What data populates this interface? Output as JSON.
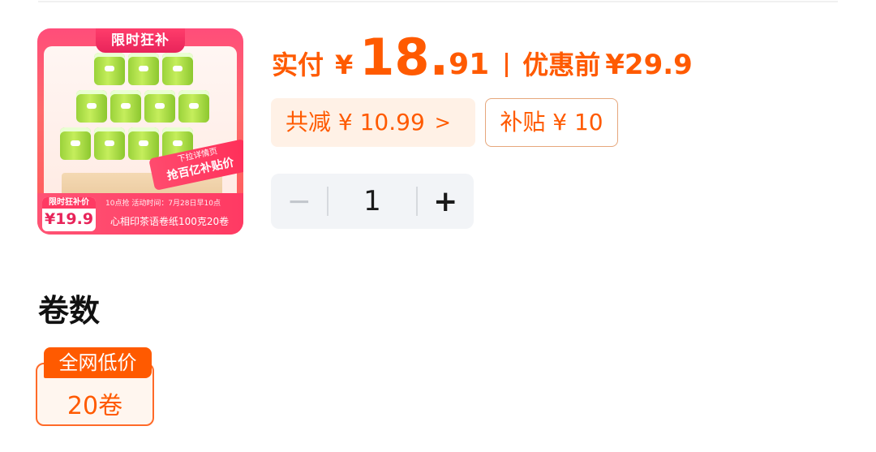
{
  "product": {
    "thumbnail": {
      "badge": "限时狂补",
      "promo_line1": "下拉详情页",
      "promo_line2": "抢百亿补贴价",
      "small_text": "10点抢 活动时间：7月28日早10点",
      "price_label": "限时狂补价",
      "price": "¥19.9",
      "name": "心相印茶语卷纸100克20卷"
    }
  },
  "price": {
    "paid_label": "实付",
    "currency": "¥",
    "paid_integer": "18.",
    "paid_decimal": "91",
    "original_label": "优惠前",
    "original_price": "¥29.9"
  },
  "discounts": {
    "total_reduction": "共减 ¥ 10.99",
    "total_chevron": ">",
    "subsidy": "补贴 ¥ 10"
  },
  "quantity": {
    "minus": "−",
    "value": "1",
    "plus": "+"
  },
  "spec": {
    "title": "卷数",
    "option_badge": "全网低价",
    "option_value": "20卷"
  },
  "colors": {
    "accent": "#ff5a00",
    "thumb_pink": "#ff3a63"
  }
}
